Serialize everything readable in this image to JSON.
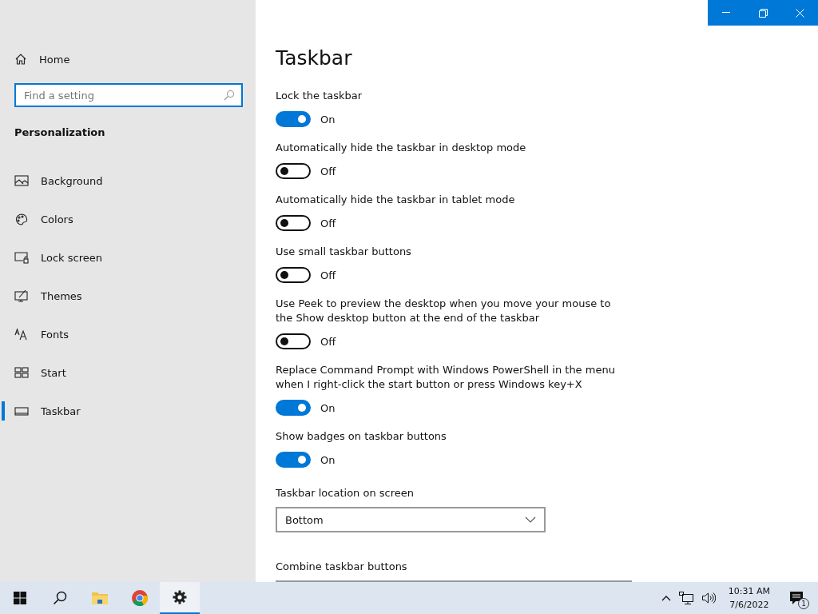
{
  "sidebar": {
    "home": "Home",
    "search": {
      "placeholder": "Find a setting"
    },
    "section": "Personalization",
    "items": [
      {
        "label": "Background",
        "kind": "background",
        "selected": false
      },
      {
        "label": "Colors",
        "kind": "colors",
        "selected": false
      },
      {
        "label": "Lock screen",
        "kind": "lock",
        "selected": false
      },
      {
        "label": "Themes",
        "kind": "themes",
        "selected": false
      },
      {
        "label": "Fonts",
        "kind": "fonts",
        "selected": false
      },
      {
        "label": "Start",
        "kind": "start",
        "selected": false
      },
      {
        "label": "Taskbar",
        "kind": "taskbar",
        "selected": true
      }
    ]
  },
  "page": {
    "title": "Taskbar",
    "settings": [
      {
        "kind": "toggle",
        "label": "Lock the taskbar",
        "on": true,
        "state": "On"
      },
      {
        "kind": "toggle",
        "label": "Automatically hide the taskbar in desktop mode",
        "on": false,
        "state": "Off"
      },
      {
        "kind": "toggle",
        "label": "Automatically hide the taskbar in tablet mode",
        "on": false,
        "state": "Off"
      },
      {
        "kind": "toggle",
        "label": "Use small taskbar buttons",
        "on": false,
        "state": "Off"
      },
      {
        "kind": "toggle",
        "label": "Use Peek to preview the desktop when you move your mouse to the Show desktop button at the end of the taskbar",
        "on": false,
        "state": "Off"
      },
      {
        "kind": "toggle",
        "label": "Replace Command Prompt with Windows PowerShell in the menu when I right-click the start button or press Windows key+X",
        "on": true,
        "state": "On"
      },
      {
        "kind": "toggle",
        "label": "Show badges on taskbar buttons",
        "on": true,
        "state": "On"
      },
      {
        "kind": "dropdown",
        "label": "Taskbar location on screen",
        "value": "Bottom"
      },
      {
        "kind": "dropdown",
        "label": "Combine taskbar buttons"
      }
    ]
  },
  "taskbar": {
    "apps": [
      {
        "kind": "start",
        "selected": false
      },
      {
        "kind": "search",
        "selected": false
      },
      {
        "kind": "folder",
        "selected": false
      },
      {
        "kind": "browser",
        "selected": false
      },
      {
        "kind": "gear",
        "selected": true
      }
    ],
    "time": "10:31 AM",
    "date": "7/6/2022",
    "notifications": "1"
  }
}
